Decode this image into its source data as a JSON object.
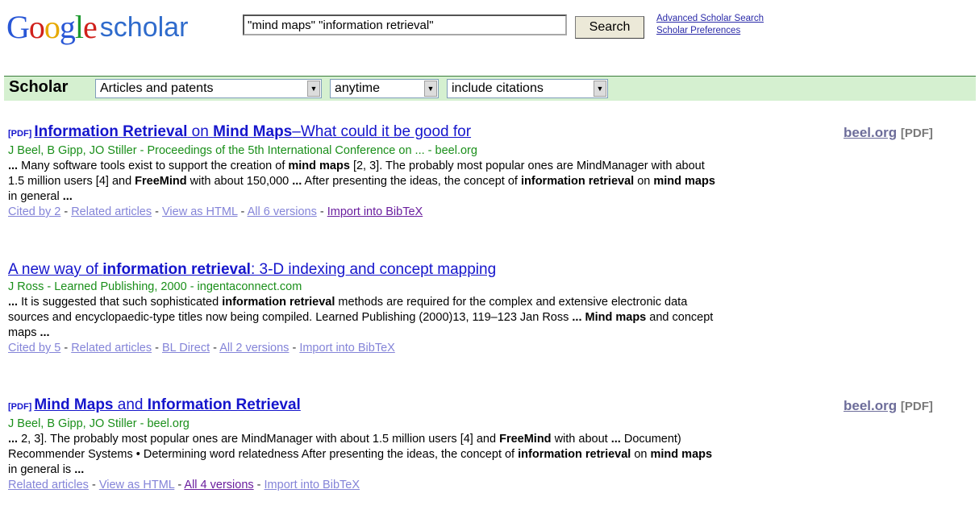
{
  "header": {
    "logo_text": "Google scholar",
    "search_value": "\"mind maps\" \"information retrieval\"",
    "search_button": "Search",
    "advanced_link": "Advanced Scholar Search",
    "prefs_link": "Scholar Preferences"
  },
  "filter_bar": {
    "label": "Scholar",
    "type_select": "Articles and patents",
    "time_select": "anytime",
    "citations_select": "include citations",
    "bg_color": "#d5f0d0"
  },
  "results": [
    {
      "tag": "[PDF]",
      "title_parts": [
        "Information Retrieval",
        " on ",
        "Mind Maps",
        "–What could it be good for"
      ],
      "meta": "J Beel, B Gipp, JO Stiller - Proceedings of the 5th International Conference on ... - beel.org",
      "snippet": [
        {
          "t": "... ",
          "b": true
        },
        {
          "t": "Many software tools exist to support the creation of ",
          "b": false
        },
        {
          "t": "mind maps",
          "b": true
        },
        {
          "t": " [2, 3]. The probably most popular ones are MindManager with about 1.5 million users [4] and ",
          "b": false
        },
        {
          "t": "FreeMind",
          "b": true
        },
        {
          "t": " with about 150,000 ",
          "b": false
        },
        {
          "t": "...",
          "b": true
        },
        {
          "t": " After presenting the ideas, the concept of ",
          "b": false
        },
        {
          "t": "information retrieval",
          "b": true
        },
        {
          "t": " on ",
          "b": false
        },
        {
          "t": "mind maps",
          "b": true
        },
        {
          "t": " in general ",
          "b": false
        },
        {
          "t": "...",
          "b": true
        }
      ],
      "links": [
        "Cited by 2",
        "Related articles",
        "View as HTML",
        "All 6 versions",
        "Import into BibTeX"
      ],
      "side_link": "beel.org",
      "side_tag": "[PDF]"
    },
    {
      "tag": "",
      "title_parts": [
        "A new way of ",
        "information retrieval",
        ": 3-D indexing and concept mapping"
      ],
      "meta": "J Ross - Learned Publishing, 2000 - ingentaconnect.com",
      "snippet": [
        {
          "t": "... ",
          "b": true
        },
        {
          "t": "It is suggested that such sophisticated ",
          "b": false
        },
        {
          "t": "information retrieval",
          "b": true
        },
        {
          "t": " methods are required for the complex and extensive electronic data sources and encyclopaedic-type titles now being compiled. Learned Publishing (2000)13, 119–123 Jan Ross ",
          "b": false
        },
        {
          "t": "... Mind maps",
          "b": true
        },
        {
          "t": " and concept maps ",
          "b": false
        },
        {
          "t": "...",
          "b": true
        }
      ],
      "links": [
        "Cited by 5",
        "Related articles",
        "BL Direct",
        "All 2 versions",
        "Import into BibTeX"
      ]
    },
    {
      "tag": "[PDF]",
      "title_parts": [
        "Mind Maps",
        " and ",
        "Information Retrieval"
      ],
      "meta": "J Beel, B Gipp, JO Stiller - beel.org",
      "snippet": [
        {
          "t": "...",
          "b": true
        },
        {
          "t": " 2, 3]. The probably most popular ones are MindManager with about 1.5 million users [4] and ",
          "b": false
        },
        {
          "t": "FreeMind",
          "b": true
        },
        {
          "t": " with about ",
          "b": false
        },
        {
          "t": "...",
          "b": true
        },
        {
          "t": " Document) Recommender Systems • Determining word relatedness After presenting the ideas, the concept of ",
          "b": false
        },
        {
          "t": "information retrieval",
          "b": true
        },
        {
          "t": " on ",
          "b": false
        },
        {
          "t": "mind maps",
          "b": true
        },
        {
          "t": " in general is ",
          "b": false
        },
        {
          "t": "...",
          "b": true
        }
      ],
      "links": [
        "Related articles",
        "View as HTML",
        "All 4 versions",
        "Import into BibTeX"
      ],
      "side_link": "beel.org",
      "side_tag": "[PDF]"
    }
  ]
}
